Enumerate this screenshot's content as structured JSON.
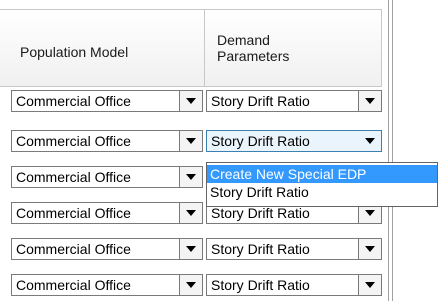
{
  "grid": {
    "headers": {
      "population": "Population Model",
      "demand_line1": "Demand",
      "demand_line2": "Parameters"
    },
    "rows": [
      {
        "population": "Commercial Office",
        "demand": "Story Drift Ratio"
      },
      {
        "population": "Commercial Office",
        "demand": "Story Drift Ratio"
      },
      {
        "population": "Commercial Office",
        "demand": ""
      },
      {
        "population": "Commercial Office",
        "demand": "Story Drift Ratio"
      },
      {
        "population": "Commercial Office",
        "demand": "Story Drift Ratio"
      },
      {
        "population": "Commercial Office",
        "demand": "Story Drift Ratio"
      }
    ]
  },
  "dropdown": {
    "options": [
      "Create New Special EDP",
      "Story Drift Ratio"
    ],
    "selected_index": 0
  },
  "colors": {
    "selection": "#3399ff",
    "focus_border": "#3c7fb1"
  }
}
